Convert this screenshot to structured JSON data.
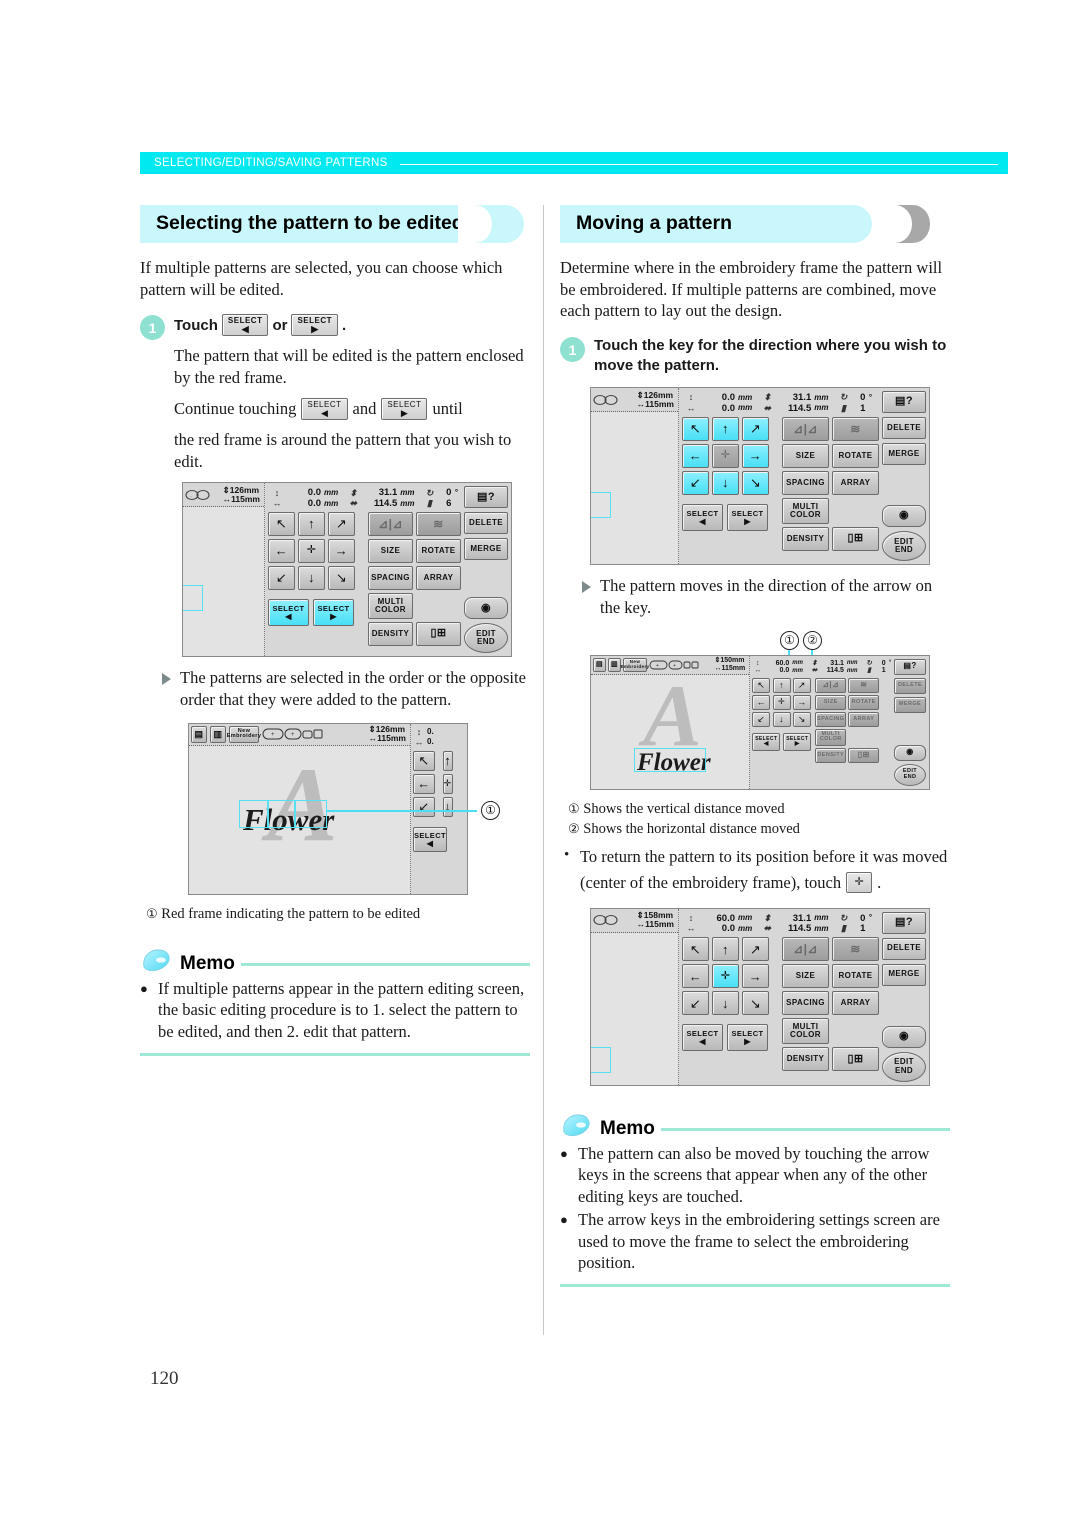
{
  "running_header": "SELECTING/EDITING/SAVING PATTERNS",
  "page_number": "120",
  "colors": {
    "header_band": "#00e8f0",
    "title_band": "#c9f7fb",
    "step_circle": "#8ee0d0",
    "memo_rule": "#9fe8d8",
    "lcd_highlight": "#48dff5"
  },
  "left": {
    "title": "Selecting the pattern to be edited",
    "intro": "If multiple patterns are selected, you can choose which pattern will be edited.",
    "step1": {
      "num": "1",
      "lead": "Touch",
      "or": "or",
      "period": ".",
      "key_label": "SELECT",
      "key_left_arrow": "◀",
      "key_right_arrow": "▶",
      "text1": "The pattern that will be edited is the pattern enclosed by the red frame.",
      "continue_lead": "Continue touching",
      "continue_and": "and",
      "continue_tail": "until",
      "text2": "the red frame is around the pattern that you wish to edit."
    },
    "note": "The patterns are selected in the order or the opposite order that they were added to the pattern.",
    "caption": "Red frame indicating the pattern to be edited",
    "caption_num": "①",
    "memo": {
      "title": "Memo",
      "bullets": [
        "If multiple patterns appear in the pattern editing screen, the basic editing procedure is to 1. select the pattern to be edited, and then 2. edit that pattern."
      ]
    },
    "lcd1": {
      "frame_h": "126mm",
      "frame_w": "115mm",
      "vert": "0.0",
      "horiz": "0.0",
      "size_h": "31.1",
      "size_w": "114.5",
      "angle": "0",
      "count": "6",
      "unit": "mm",
      "deg": "°",
      "keys": {
        "size": "SIZE",
        "rotate": "ROTATE",
        "spacing": "SPACING",
        "array": "ARRAY",
        "multi_color": "MULTI COLOR",
        "density": "DENSITY",
        "delete": "DELETE",
        "merge": "MERGE",
        "edit_end": "EDIT END",
        "select": "SELECT"
      },
      "select_highlighted": true,
      "arrows_highlighted": false,
      "center_highlighted": false
    },
    "lcd2": {
      "toolbar_new": "New Embroidery",
      "frame_h": "126mm",
      "frame_w": "115mm",
      "pattern_text": "Flower",
      "ghost_letter": "A",
      "select": "SELECT",
      "callout": "①"
    }
  },
  "right": {
    "title": "Moving a pattern",
    "intro": "Determine where in the embroidery frame the pattern will be embroidered. If multiple patterns are combined, move each pattern to lay out the design.",
    "step1": {
      "num": "1",
      "head": "Touch the key for the direction where you wish to move the pattern."
    },
    "note": "The pattern moves in the direction of the arrow on the key.",
    "captions": [
      {
        "num": "①",
        "text": "Shows the vertical distance moved"
      },
      {
        "num": "②",
        "text": "Shows the horizontal distance moved"
      }
    ],
    "return_note": {
      "part1": "To return the pattern to its position before it was moved (center of the embroidery frame),",
      "part2": "touch",
      "part3": "."
    },
    "memo": {
      "title": "Memo",
      "bullets": [
        "The pattern can also be moved by touching the arrow keys in the screens that appear when any of the other editing keys are touched.",
        "The arrow keys in the embroidering settings screen are used to move the frame to select the embroidering position."
      ]
    },
    "lcd1": {
      "frame_h": "126mm",
      "frame_w": "115mm",
      "vert": "0.0",
      "horiz": "0.0",
      "size_h": "31.1",
      "size_w": "114.5",
      "angle": "0",
      "count": "1",
      "unit": "mm",
      "deg": "°",
      "keys": {
        "size": "SIZE",
        "rotate": "ROTATE",
        "spacing": "SPACING",
        "array": "ARRAY",
        "multi_color": "MULTI COLOR",
        "density": "DENSITY",
        "delete": "DELETE",
        "merge": "MERGE",
        "edit_end": "EDIT END",
        "select": "SELECT"
      },
      "arrows_highlighted": true
    },
    "lcd2": {
      "toolbar_new": "New Embroidery",
      "frame_h": "150mm",
      "frame_w": "115mm",
      "vert": "60.0",
      "horiz": "0.0",
      "size_h": "31.1",
      "size_w": "114.5",
      "angle": "0",
      "count": "1",
      "unit": "mm",
      "deg": "°",
      "pattern_text": "Flower",
      "ghost_letter": "A",
      "callout1": "①",
      "callout2": "②"
    },
    "lcd3": {
      "frame_h": "158mm",
      "frame_w": "115mm",
      "vert": "60.0",
      "horiz": "0.0",
      "size_h": "31.1",
      "size_w": "114.5",
      "angle": "0",
      "count": "1",
      "unit": "mm",
      "deg": "°",
      "keys": {
        "size": "SIZE",
        "rotate": "ROTATE",
        "spacing": "SPACING",
        "array": "ARRAY",
        "multi_color": "MULTI COLOR",
        "density": "DENSITY",
        "delete": "DELETE",
        "merge": "MERGE",
        "edit_end": "EDIT END",
        "select": "SELECT"
      },
      "center_highlighted": true
    }
  },
  "glyphs": {
    "arrow_ul": "↖",
    "arrow_up": "↑",
    "arrow_ur": "↗",
    "arrow_left": "←",
    "arrow_center": "✛",
    "arrow_right": "→",
    "arrow_dl": "↙",
    "arrow_down": "↓",
    "arrow_dr": "↘",
    "sel_left": "◀",
    "sel_right": "▶",
    "vert_icon": "↕",
    "horiz_icon": "↔",
    "rot_icon": "↻",
    "thread_icon": "▮"
  }
}
